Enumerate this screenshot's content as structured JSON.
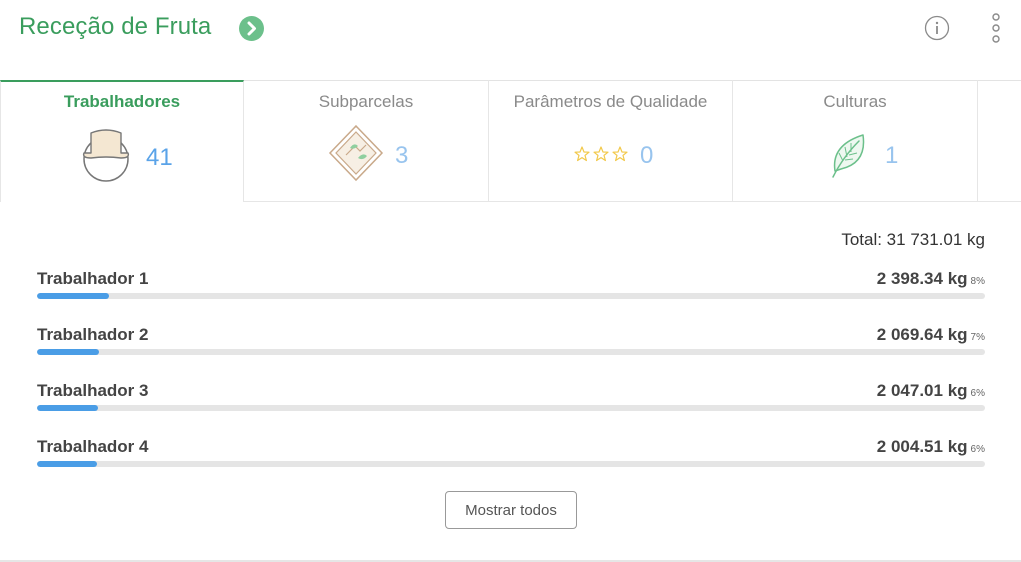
{
  "header": {
    "title": "Receção de Fruta",
    "go_icon": "chevron-right-circle-icon",
    "info_icon": "info-icon",
    "more_icon": "more-vertical-icon"
  },
  "tabs": [
    {
      "label": "Trabalhadores",
      "count": "41",
      "icon": "worker-hat-icon",
      "active": true
    },
    {
      "label": "Subparcelas",
      "count": "3",
      "icon": "field-parcel-icon",
      "active": false
    },
    {
      "label": "Parâmetros de Qualidade",
      "count": "0",
      "icon": "stars-icon",
      "active": false
    },
    {
      "label": "Culturas",
      "count": "1",
      "icon": "leaf-icon",
      "active": false
    }
  ],
  "summary": {
    "total": "Total: 31 731.01 kg"
  },
  "rows": [
    {
      "name": "Trabalhador 1",
      "value": "2 398.34 kg",
      "pct": "8%",
      "fraction": 0.0756
    },
    {
      "name": "Trabalhador 2",
      "value": "2 069.64 kg",
      "pct": "7%",
      "fraction": 0.0652
    },
    {
      "name": "Trabalhador 3",
      "value": "2 047.01 kg",
      "pct": "6%",
      "fraction": 0.0645
    },
    {
      "name": "Trabalhador 4",
      "value": "2 004.51 kg",
      "pct": "6%",
      "fraction": 0.0632
    }
  ],
  "actions": {
    "show_all": "Mostrar todos"
  },
  "colors": {
    "brand_green": "#3a9d5d",
    "accent_blue": "#4a9de6",
    "icon_green": "#6cc08b",
    "star_yellow": "#f2c94c"
  }
}
